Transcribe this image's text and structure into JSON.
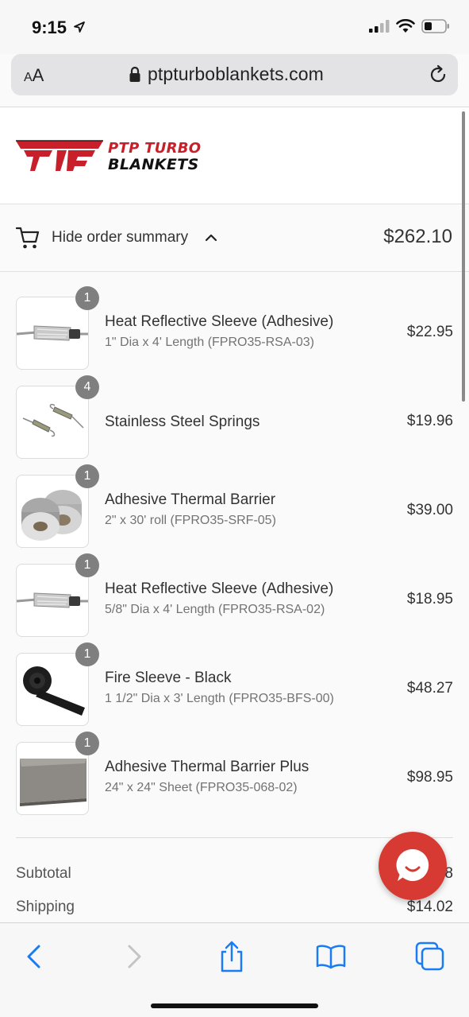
{
  "status": {
    "time": "9:15"
  },
  "browser": {
    "text_size_label": "AA",
    "url": "ptpturboblankets.com"
  },
  "brand": {
    "logo_line1": "PTP TURBO",
    "logo_line2": "BLANKETS",
    "accent_color": "#c8202a"
  },
  "summary": {
    "toggle_label": "Hide order summary",
    "total": "$262.10"
  },
  "items": [
    {
      "qty": "1",
      "name": "Heat Reflective Sleeve (Adhesive)",
      "variant": "1\" Dia x 4' Length (FPRO35-RSA-03)",
      "price": "$22.95",
      "image": "sleeve-image"
    },
    {
      "qty": "4",
      "name": "Stainless Steel Springs",
      "variant": "",
      "price": "$19.96",
      "image": "springs-image"
    },
    {
      "qty": "1",
      "name": "Adhesive Thermal Barrier",
      "variant": "2\" x 30' roll (FPRO35-SRF-05)",
      "price": "$39.00",
      "image": "tape-roll-image"
    },
    {
      "qty": "1",
      "name": "Heat Reflective Sleeve (Adhesive)",
      "variant": "5/8\" Dia x 4' Length (FPRO35-RSA-02)",
      "price": "$18.95",
      "image": "sleeve-image"
    },
    {
      "qty": "1",
      "name": "Fire Sleeve - Black",
      "variant": "1 1/2\" Dia x 3' Length (FPRO35-BFS-00)",
      "price": "$48.27",
      "image": "black-sleeve-image"
    },
    {
      "qty": "1",
      "name": "Adhesive Thermal Barrier Plus",
      "variant": "24\" x 24\" Sheet (FPRO35-068-02)",
      "price": "$98.95",
      "image": "sheet-image"
    }
  ],
  "totals": {
    "subtotal_label": "Subtotal",
    "subtotal_value": "8",
    "shipping_label": "Shipping",
    "shipping_value": "$14.02"
  }
}
